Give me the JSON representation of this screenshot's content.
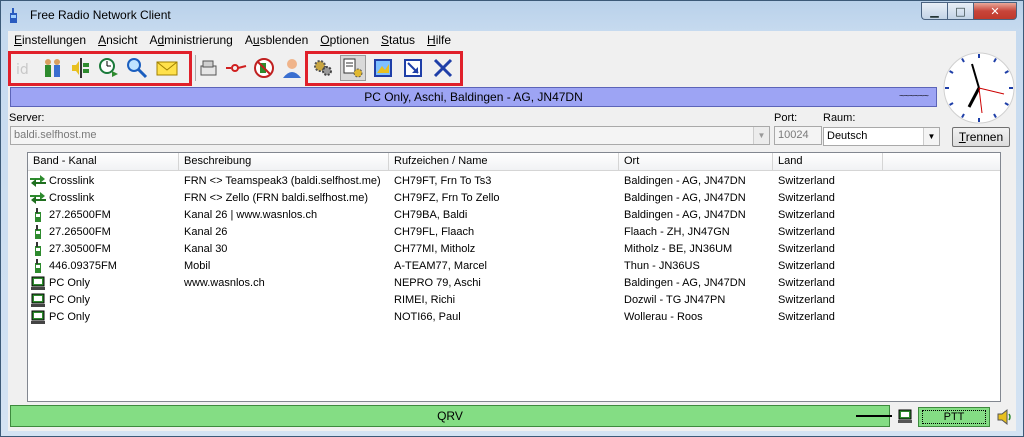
{
  "window": {
    "title": "Free Radio Network Client"
  },
  "menu": [
    {
      "label": "Einstellungen",
      "key": "E"
    },
    {
      "label": "Ansicht",
      "key": "A"
    },
    {
      "label": "Administrierung",
      "key": "d"
    },
    {
      "label": "Ausblenden",
      "key": "u"
    },
    {
      "label": "Optionen",
      "key": "O"
    },
    {
      "label": "Status",
      "key": "S"
    },
    {
      "label": "Hilfe",
      "key": "H"
    }
  ],
  "toolbar": {
    "icons": [
      "id-icon",
      "users-icon",
      "audio-level-icon",
      "clock-alarm-icon",
      "search-icon",
      "mail-icon",
      "hand-icon",
      "connect-icon",
      "phone-user-icon",
      "person-icon",
      "gears-icon",
      "admin-config-icon",
      "map-icon",
      "resize-icon",
      "close-x-icon"
    ]
  },
  "status_top": {
    "text": "PC Only, Aschi, Baldingen - AG, JN47DN",
    "wave": "~~~~~~"
  },
  "server": {
    "label": "Server:",
    "value": "baldi.selfhost.me"
  },
  "port": {
    "label": "Port:",
    "value": "10024"
  },
  "room": {
    "label": "Raum:",
    "value": "Deutsch"
  },
  "disconnect_button": "Trennen",
  "table": {
    "columns": [
      "Band - Kanal",
      "Beschreibung",
      "Rufzeichen / Name",
      "Ort",
      "Land"
    ],
    "rows": [
      {
        "icon": "crosslink-icon",
        "band": "Crosslink",
        "desc": "FRN <> Teamspeak3 (baldi.selfhost.me)",
        "call": "CH79FT, Frn To Ts3",
        "ort": "Baldingen - AG, JN47DN",
        "land": "Switzerland"
      },
      {
        "icon": "crosslink-icon",
        "band": "Crosslink",
        "desc": "FRN <> Zello (FRN baldi.selfhost.me)",
        "call": "CH79FZ, Frn To Zello",
        "ort": "Baldingen - AG, JN47DN",
        "land": "Switzerland"
      },
      {
        "icon": "radio-icon",
        "band": "27.26500FM",
        "desc": "Kanal 26 | www.wasnlos.ch",
        "call": "CH79BA, Baldi",
        "ort": "Baldingen - AG, JN47DN",
        "land": "Switzerland"
      },
      {
        "icon": "radio-icon",
        "band": "27.26500FM",
        "desc": "Kanal 26",
        "call": "CH79FL, Flaach",
        "ort": "Flaach - ZH, JN47GN",
        "land": "Switzerland"
      },
      {
        "icon": "radio-icon",
        "band": "27.30500FM",
        "desc": "Kanal 30",
        "call": "CH77MI, Mitholz",
        "ort": "Mitholz - BE, JN36UM",
        "land": "Switzerland"
      },
      {
        "icon": "radio-icon",
        "band": "446.09375FM",
        "desc": "Mobil",
        "call": "A-TEAM77, Marcel",
        "ort": "Thun - JN36US",
        "land": "Switzerland"
      },
      {
        "icon": "pc-icon",
        "band": "PC Only",
        "desc": "www.wasnlos.ch",
        "call": "NEPRO 79, Aschi",
        "ort": "Baldingen - AG, JN47DN",
        "land": "Switzerland"
      },
      {
        "icon": "pc-icon",
        "band": "PC Only",
        "desc": "",
        "call": "RIMEI, Richi",
        "ort": "Dozwil - TG JN47PN",
        "land": "Switzerland"
      },
      {
        "icon": "pc-icon",
        "band": "PC Only",
        "desc": "",
        "call": "NOTI66, Paul",
        "ort": "Wollerau - Roos",
        "land": "Switzerland"
      }
    ]
  },
  "status_bottom": {
    "text": "QRV"
  },
  "ptt": {
    "label": "PTT"
  },
  "colors": {
    "status_top": "#9da4f4",
    "status_bottom": "#84dd84",
    "highlight": "#e0202a"
  }
}
